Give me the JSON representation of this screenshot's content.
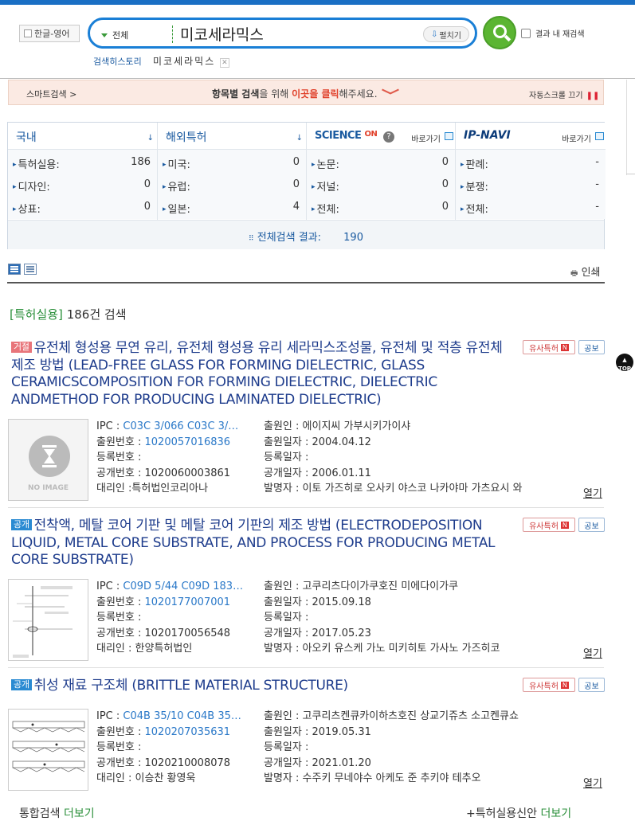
{
  "header": {
    "lang_toggle": "한글-영어",
    "search_scope": "전체",
    "search_query": "미코세라믹스",
    "expand_label": "펼치기",
    "research_label": "결과 내 재검색",
    "history_label": "검색히스토리",
    "history_item": "미코세라믹스"
  },
  "smartbar": {
    "label": "스마트검색 >",
    "msg_bold": "항목별 검색",
    "msg_mid": "을 위해 ",
    "msg_red": "이곳을 클릭",
    "msg_end": "해주세요.",
    "autoscroll": "자동스크롤 끄기",
    "pause_icon": "❚❚"
  },
  "summary": {
    "domestic": {
      "title": "국내",
      "rows": [
        {
          "label": "특허실용:",
          "value": "186"
        },
        {
          "label": "디자인:",
          "value": "0"
        },
        {
          "label": "상표:",
          "value": "0"
        }
      ]
    },
    "foreign": {
      "title": "해외특허",
      "rows": [
        {
          "label": "미국:",
          "value": "0"
        },
        {
          "label": "유럽:",
          "value": "0"
        },
        {
          "label": "일본:",
          "value": "4"
        }
      ]
    },
    "science": {
      "logo": "SCIENCE",
      "logo_on": "ON",
      "goto": "바로가기",
      "rows": [
        {
          "label": "논문:",
          "value": "0"
        },
        {
          "label": "저널:",
          "value": "0"
        },
        {
          "label": "전체:",
          "value": "0"
        }
      ]
    },
    "ipnavi": {
      "logo": "IP-NAVI",
      "goto": "바로가기",
      "rows": [
        {
          "label": "판례:",
          "value": "-"
        },
        {
          "label": "분쟁:",
          "value": "-"
        },
        {
          "label": "전체:",
          "value": "-"
        }
      ]
    },
    "total_label": "전체검색 결과:",
    "total_value": "190"
  },
  "toolbar": {
    "print": "인쇄"
  },
  "results_heading": {
    "category": "[특허실용]",
    "count": "186",
    "suffix": "건 검색"
  },
  "fields_labels": {
    "ipc": "IPC :",
    "appno": "출원번호 :",
    "regno": "등록번호 :",
    "pubno": "공개번호 :",
    "agent": "대리인 :",
    "applicant": "출원인 :",
    "appdate": "출원일자 :",
    "regdate": "등록일자 :",
    "pubdate": "공개일자 :",
    "inventor": "발명자 :"
  },
  "common": {
    "similar": "유사특허",
    "similar_n": "N",
    "pub": "공보",
    "open": "열기",
    "noimage": "NO IMAGE",
    "top": "TOP"
  },
  "results": [
    {
      "status": "거절",
      "title": "유전체 형성용 무연 유리, 유전체 형성용 유리 세라믹스조성물, 유전체 및 적층 유전체 제조 방법 (LEAD-FREE GLASS FOR FORMING DIELECTRIC, GLASS CERAMICSCOMPOSITION FOR FORMING DIELECTRIC, DIELECTRIC ANDMETHOD FOR PRODUCING LAMINATED DIELECTRIC)",
      "ipc": "C03C 3/066 C03C 3/…",
      "appno": "1020057016836",
      "regno": "",
      "pubno": "1020060003861",
      "agent": "특허법인코리아나",
      "applicant": "에이지씨 가부시키가이샤",
      "appdate": "2004.04.12",
      "regdate": "",
      "pubdate": "2006.01.11",
      "inventor": "이토 가즈히로 오사키 야스코 나카야마 가츠요시 와"
    },
    {
      "status": "공개",
      "title": "전착액, 메탈 코어 기판 및 메탈 코어 기판의 제조 방법 (ELECTRODEPOSITION LIQUID, METAL CORE SUBSTRATE, AND PROCESS FOR PRODUCING METAL CORE SUBSTRATE)",
      "ipc": "C09D 5/44 C09D 183…",
      "appno": "1020177007001",
      "regno": "",
      "pubno": "1020170056548",
      "agent": "한양특허법인",
      "applicant": "고쿠리츠다이가쿠호진 미에다이가쿠",
      "appdate": "2015.09.18",
      "regdate": "",
      "pubdate": "2017.05.23",
      "inventor": "아오키 유스케 가노 미키히토 가사노 가즈히코"
    },
    {
      "status": "공개",
      "title": "취성 재료 구조체 (BRITTLE MATERIAL STRUCTURE)",
      "ipc": "C04B 35/10 C04B 35…",
      "appno": "1020207035631",
      "regno": "",
      "pubno": "1020210008078",
      "agent": "이승찬 황영욱",
      "applicant": "고쿠리츠켄큐카이하츠호진 상교기쥬츠 소고켄큐쇼",
      "appdate": "2019.05.31",
      "regdate": "",
      "pubdate": "2021.01.20",
      "inventor": "수주키 무네야수 아케도 준 추키야 테추오"
    }
  ],
  "footer": {
    "integrated": "통합검색",
    "more": "더보기",
    "patent_plus": "+특허실용신안",
    "more2": "더보기"
  }
}
